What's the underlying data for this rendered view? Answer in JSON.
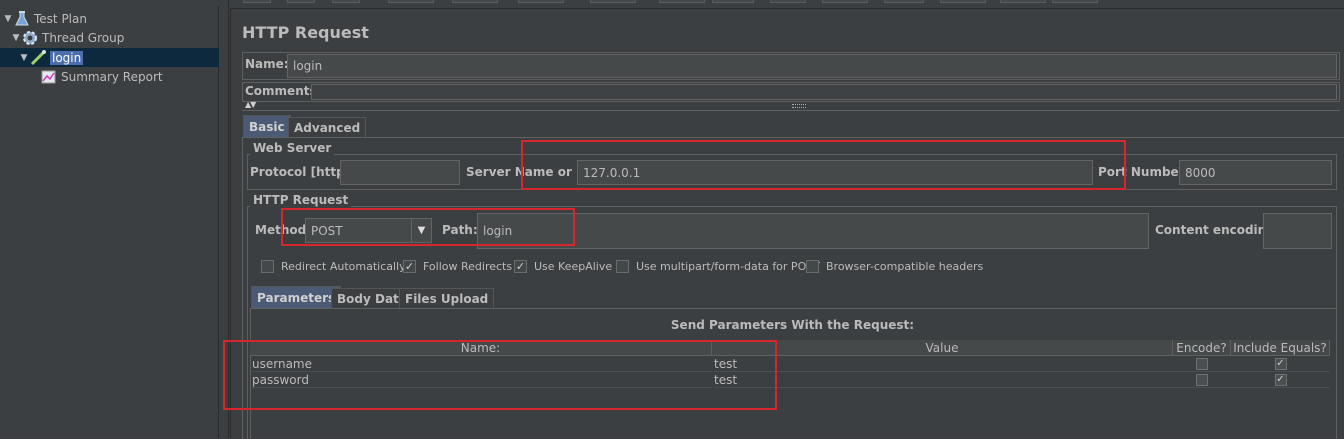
{
  "tree": {
    "items": [
      {
        "label": "Test Plan",
        "icon": "flask-icon",
        "toggle": "▼"
      },
      {
        "label": "Thread Group",
        "icon": "gear-icon",
        "toggle": "▼"
      },
      {
        "label": "login",
        "icon": "pipette-icon",
        "toggle": "▼"
      },
      {
        "label": "Summary Report",
        "icon": "chart-icon",
        "toggle": ""
      }
    ]
  },
  "panel": {
    "title": "HTTP Request",
    "name_label": "Name:",
    "name_value": "login",
    "comments_label": "Comments:",
    "collapse_glyph": "▲▼",
    "tabs": [
      "Basic",
      "Advanced"
    ]
  },
  "web_server": {
    "title": "Web Server",
    "protocol_label": "Protocol [http]:",
    "protocol_value": "",
    "server_label": "Server Name or IP:",
    "server_value": "127.0.0.1",
    "port_label": "Port Number:",
    "port_value": "8000"
  },
  "http_request": {
    "title": "HTTP Request",
    "method_label": "Method:",
    "method_value": "POST",
    "path_label": "Path:",
    "path_value": "login",
    "encoding_label": "Content encoding:",
    "encoding_value": "",
    "checkboxes": [
      {
        "label": "Redirect Automatically",
        "checked": false
      },
      {
        "label": "Follow Redirects",
        "checked": true
      },
      {
        "label": "Use KeepAlive",
        "checked": true
      },
      {
        "label": "Use multipart/form-data for POST",
        "checked": false
      },
      {
        "label": "Browser-compatible headers",
        "checked": false
      }
    ]
  },
  "params": {
    "tabs": [
      "Parameters",
      "Body Data",
      "Files Upload"
    ],
    "caption": "Send Parameters With the Request:",
    "columns": [
      "Name:",
      "Value",
      "Encode?",
      "Include Equals?"
    ],
    "rows": [
      {
        "name": "username",
        "value": "test",
        "encode": false,
        "include_equals": true
      },
      {
        "name": "password",
        "value": "test",
        "encode": false,
        "include_equals": true
      }
    ]
  },
  "colors": {
    "background": "#3c3f41",
    "selection": "#4b6eaf",
    "highlight": "#d9262c"
  }
}
